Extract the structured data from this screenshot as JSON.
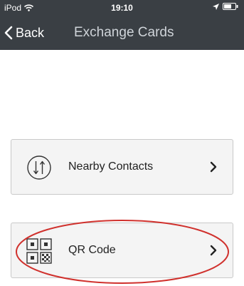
{
  "status_bar": {
    "carrier": "iPod",
    "time": "19:10",
    "wifi_icon": "wifi-icon",
    "location_icon": "location-arrow-icon",
    "battery_icon": "battery-icon"
  },
  "nav": {
    "back_label": "Back",
    "title": "Exchange Cards",
    "back_icon": "chevron-left-icon"
  },
  "options": [
    {
      "label": "Nearby Contacts",
      "icon": "exchange-arrows-icon"
    },
    {
      "label": "QR Code",
      "icon": "qr-code-icon"
    }
  ],
  "colors": {
    "nav_background": "#3a3f44",
    "annotation": "#d0312d"
  }
}
